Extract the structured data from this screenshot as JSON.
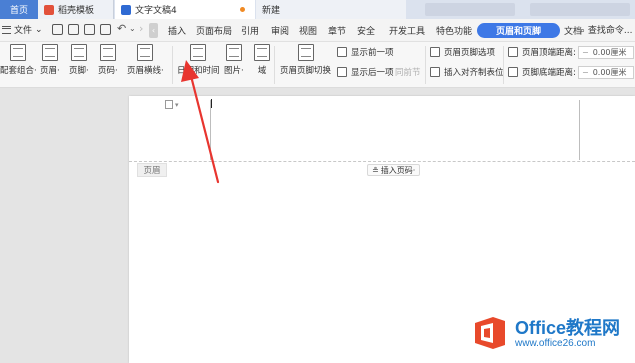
{
  "tabs": [
    {
      "label": "首页"
    },
    {
      "label": "稻壳模板"
    },
    {
      "label": "文字文稿4"
    },
    {
      "label": "新建"
    }
  ],
  "menu": {
    "file_label": "文件",
    "items": [
      "插入",
      "页面布局",
      "引用",
      "审阅",
      "视图",
      "章节",
      "安全",
      "开发工具",
      "特色功能"
    ],
    "active_item": "页眉和页脚",
    "overflow_item": "文档",
    "search_label": "查找命令..."
  },
  "ribbon": {
    "large_buttons": [
      {
        "label": "配套组合·",
        "icon": "template-combo-icon"
      },
      {
        "label": "页眉·",
        "icon": "header-icon"
      },
      {
        "label": "页脚·",
        "icon": "footer-icon"
      },
      {
        "label": "页码·",
        "icon": "page-number-icon"
      },
      {
        "label": "页眉横线·",
        "icon": "header-line-icon"
      },
      {
        "label": "日期和时间",
        "icon": "calendar-icon"
      },
      {
        "label": "图片·",
        "icon": "picture-icon"
      },
      {
        "label": "域",
        "icon": "field-icon"
      },
      {
        "label": "页眉页脚切换",
        "icon": "switch-icon"
      }
    ],
    "small_buttons": [
      {
        "label": "显示前一项",
        "icon": "prev-icon"
      },
      {
        "label": "显示后一项",
        "icon": "next-icon"
      },
      {
        "label": "同前节",
        "icon": "same-as-prev-icon",
        "disabled": true
      },
      {
        "label": "页眉页脚选项",
        "icon": "options-icon"
      },
      {
        "label": "插入对齐制表位",
        "icon": "tab-stop-icon"
      }
    ],
    "distance": [
      {
        "label": "页眉顶端距离:",
        "value": "0.00厘米"
      },
      {
        "label": "页脚底端距离:",
        "value": "0.00厘米"
      }
    ]
  },
  "document": {
    "header_label": "页眉",
    "insert_page_number": "插入页码·"
  },
  "watermark": {
    "title": "Office教程网",
    "url": "www.office26.com"
  },
  "colors": {
    "accent": "#3d78e6",
    "arrow": "#e8352f",
    "watermark": "#1f78c8"
  }
}
